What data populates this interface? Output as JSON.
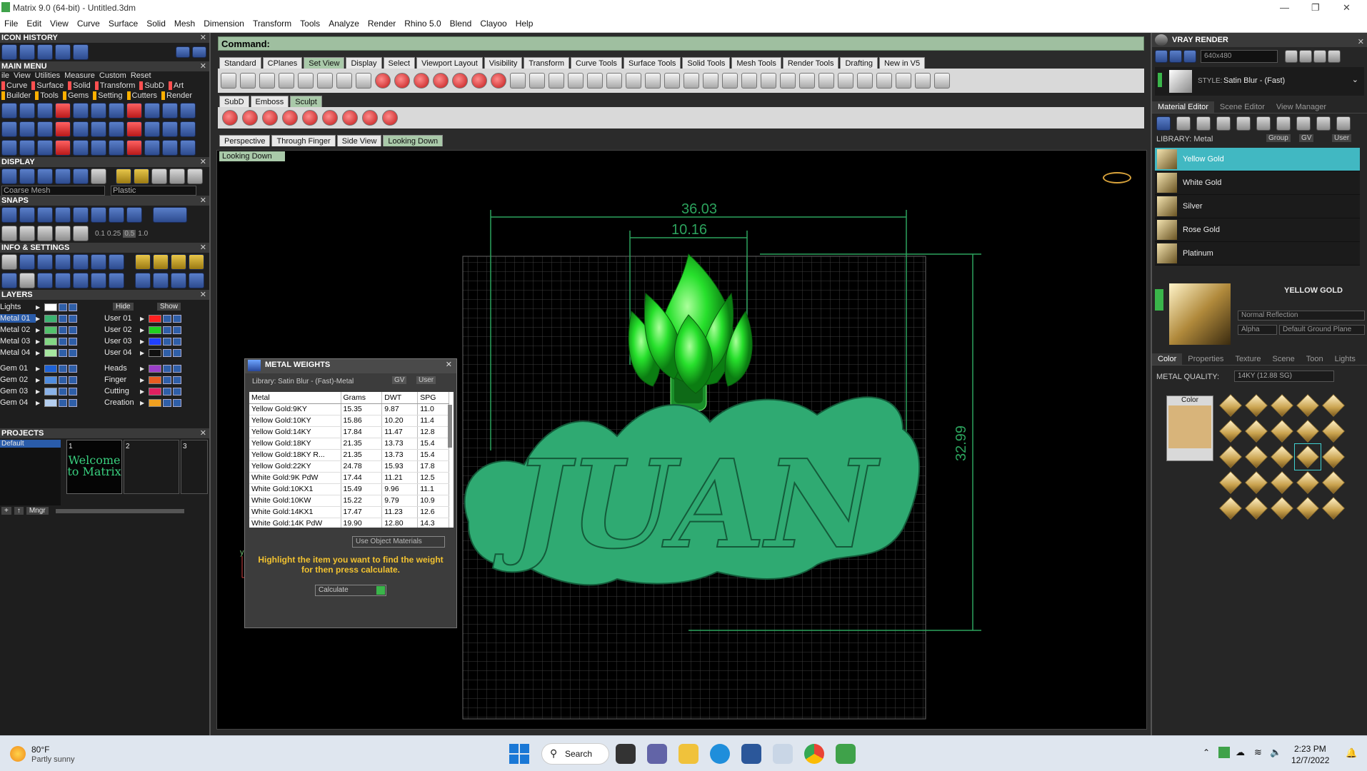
{
  "window": {
    "title": "Matrix 9.0 (64-bit) - Untitled.3dm"
  },
  "menubar": [
    "File",
    "Edit",
    "View",
    "Curve",
    "Surface",
    "Solid",
    "Mesh",
    "Dimension",
    "Transform",
    "Tools",
    "Analyze",
    "Render",
    "Rhino 5.0",
    "Blend",
    "Clayoo",
    "Help"
  ],
  "left": {
    "icon_history": "ICON HISTORY",
    "main_menu": "MAIN MENU",
    "main_menu_items": [
      "ile",
      "View",
      "Utilities",
      "Measure",
      "Custom",
      "Reset"
    ],
    "main_menu_cats1": [
      "Curve",
      "Surface",
      "Solid",
      "Transform",
      "SubD",
      "Art"
    ],
    "main_menu_cats2": [
      "Builder",
      "Tools",
      "Gems",
      "Setting",
      "Cutters",
      "Render"
    ],
    "display": "DISPLAY",
    "display_mesh": "Coarse Mesh",
    "display_mat": "Plastic",
    "snaps": "SNAPS",
    "snap_vals": [
      "0.1",
      "0.25",
      "0.5",
      "1.0"
    ],
    "info": "INFO & SETTINGS",
    "layers": "LAYERS",
    "layers_hide": "Hide",
    "layers_show": "Show",
    "layers_left": [
      {
        "name": "Lights",
        "color": "#ffffff",
        "sel": false
      },
      {
        "name": "Metal 01",
        "color": "#3cb371",
        "sel": true
      },
      {
        "name": "Metal 02",
        "color": "#53c16c",
        "sel": false
      },
      {
        "name": "Metal 03",
        "color": "#83d684",
        "sel": false
      },
      {
        "name": "Metal 04",
        "color": "#a7e6a0",
        "sel": false
      },
      {
        "name": "Gem 01",
        "color": "#1e62d6",
        "sel": false
      },
      {
        "name": "Gem 02",
        "color": "#4f8de0",
        "sel": false
      },
      {
        "name": "Gem 03",
        "color": "#8ab2e8",
        "sel": false
      },
      {
        "name": "Gem 04",
        "color": "#b5cff0",
        "sel": false
      }
    ],
    "layers_right": [
      {
        "name": "User 01",
        "color": "#ff2020"
      },
      {
        "name": "User 02",
        "color": "#20d020"
      },
      {
        "name": "User 03",
        "color": "#2040ff"
      },
      {
        "name": "User 04",
        "color": "#101010"
      },
      {
        "name": "Heads",
        "color": "#9b3fc8"
      },
      {
        "name": "Finger",
        "color": "#e85c20"
      },
      {
        "name": "Cutting",
        "color": "#e02060"
      },
      {
        "name": "Creation",
        "color": "#f0a020"
      }
    ],
    "projects": "PROJECTS",
    "project_default": "Default",
    "project_slots": [
      "1",
      "2",
      "3"
    ],
    "welcome": "Welcome to Matrix",
    "mngr": "Mngr"
  },
  "main": {
    "command": "Command:",
    "tabs1": [
      {
        "label": "Standard",
        "on": false
      },
      {
        "label": "CPlanes",
        "on": false
      },
      {
        "label": "Set View",
        "on": true
      },
      {
        "label": "Display",
        "on": false
      },
      {
        "label": "Select",
        "on": false
      },
      {
        "label": "Viewport Layout",
        "on": false
      },
      {
        "label": "Visibility",
        "on": false
      },
      {
        "label": "Transform",
        "on": false
      },
      {
        "label": "Curve Tools",
        "on": false
      },
      {
        "label": "Surface Tools",
        "on": false
      },
      {
        "label": "Solid Tools",
        "on": false
      },
      {
        "label": "Mesh Tools",
        "on": false
      },
      {
        "label": "Render Tools",
        "on": false
      },
      {
        "label": "Drafting",
        "on": false
      },
      {
        "label": "New in V5",
        "on": false
      }
    ],
    "tabs2": [
      {
        "label": "SubD",
        "on": false
      },
      {
        "label": "Emboss",
        "on": false
      },
      {
        "label": "Sculpt",
        "on": true
      }
    ],
    "view_tabs": [
      {
        "label": "Perspective",
        "on": false
      },
      {
        "label": "Through Finger",
        "on": false
      },
      {
        "label": "Side View",
        "on": false
      },
      {
        "label": "Looking Down",
        "on": true
      }
    ],
    "view_label": "Looking Down",
    "dims": {
      "width": "36.03",
      "inner": "10.16",
      "height": "32.99"
    },
    "axis_y": "y",
    "axis_x": "x",
    "pendant_text": "JUAN"
  },
  "metal_weights": {
    "title": "METAL WEIGHTS",
    "library": "Library: Satin Blur - (Fast)-Metal",
    "gv": "GV",
    "user": "User",
    "columns": [
      "Metal",
      "Grams",
      "DWT",
      "SPG"
    ],
    "rows": [
      [
        "Yellow Gold:9KY",
        "15.35",
        "9.87",
        "11.0"
      ],
      [
        "Yellow Gold:10KY",
        "15.86",
        "10.20",
        "11.4"
      ],
      [
        "Yellow Gold:14KY",
        "17.84",
        "11.47",
        "12.8"
      ],
      [
        "Yellow Gold:18KY",
        "21.35",
        "13.73",
        "15.4"
      ],
      [
        "Yellow Gold:18KY R...",
        "21.35",
        "13.73",
        "15.4"
      ],
      [
        "Yellow Gold:22KY",
        "24.78",
        "15.93",
        "17.8"
      ],
      [
        "White Gold:9K PdW",
        "17.44",
        "11.21",
        "12.5"
      ],
      [
        "White Gold:10KX1",
        "15.49",
        "9.96",
        "11.1"
      ],
      [
        "White Gold:10KW",
        "15.22",
        "9.79",
        "10.9"
      ],
      [
        "White Gold:14KX1",
        "17.47",
        "11.23",
        "12.6"
      ],
      [
        "White Gold:14K PdW",
        "19.90",
        "12.80",
        "14.3"
      ]
    ],
    "use_obj": "Use Object Materials",
    "help": "Highlight the item you want to find the weight for then press calculate.",
    "calculate": "Calculate"
  },
  "right": {
    "title": "VRAY RENDER",
    "res": "640x480",
    "style_label": "STYLE:",
    "style": "Satin Blur - (Fast)",
    "tabs": [
      {
        "label": "Material Editor",
        "on": true
      },
      {
        "label": "Scene Editor",
        "on": false
      },
      {
        "label": "View Manager",
        "on": false
      }
    ],
    "library": "LIBRARY: Metal",
    "group": "Group",
    "gv": "GV",
    "user": "User",
    "materials": [
      {
        "name": "Yellow Gold",
        "sel": true
      },
      {
        "name": "White Gold",
        "sel": false
      },
      {
        "name": "Silver",
        "sel": false
      },
      {
        "name": "Rose Gold",
        "sel": false
      },
      {
        "name": "Platinum",
        "sel": false
      }
    ],
    "preview_name": "YELLOW GOLD",
    "reflection": "Normal Reflection",
    "alpha": "Alpha",
    "ground": "Default Ground Plane",
    "subtabs": [
      {
        "label": "Color",
        "on": true
      },
      {
        "label": "Properties",
        "on": false
      },
      {
        "label": "Texture",
        "on": false
      },
      {
        "label": "Scene",
        "on": false
      },
      {
        "label": "Toon",
        "on": false
      },
      {
        "label": "Lights",
        "on": false
      }
    ],
    "quality_label": "METAL QUALITY:",
    "quality": "14KY     (12.88 SG)",
    "color_label": "Color",
    "swatch": "#d8b47a"
  },
  "taskbar": {
    "temp": "80°F",
    "weather": "Partly sunny",
    "search": "Search",
    "time": "2:23 PM",
    "date": "12/7/2022"
  }
}
